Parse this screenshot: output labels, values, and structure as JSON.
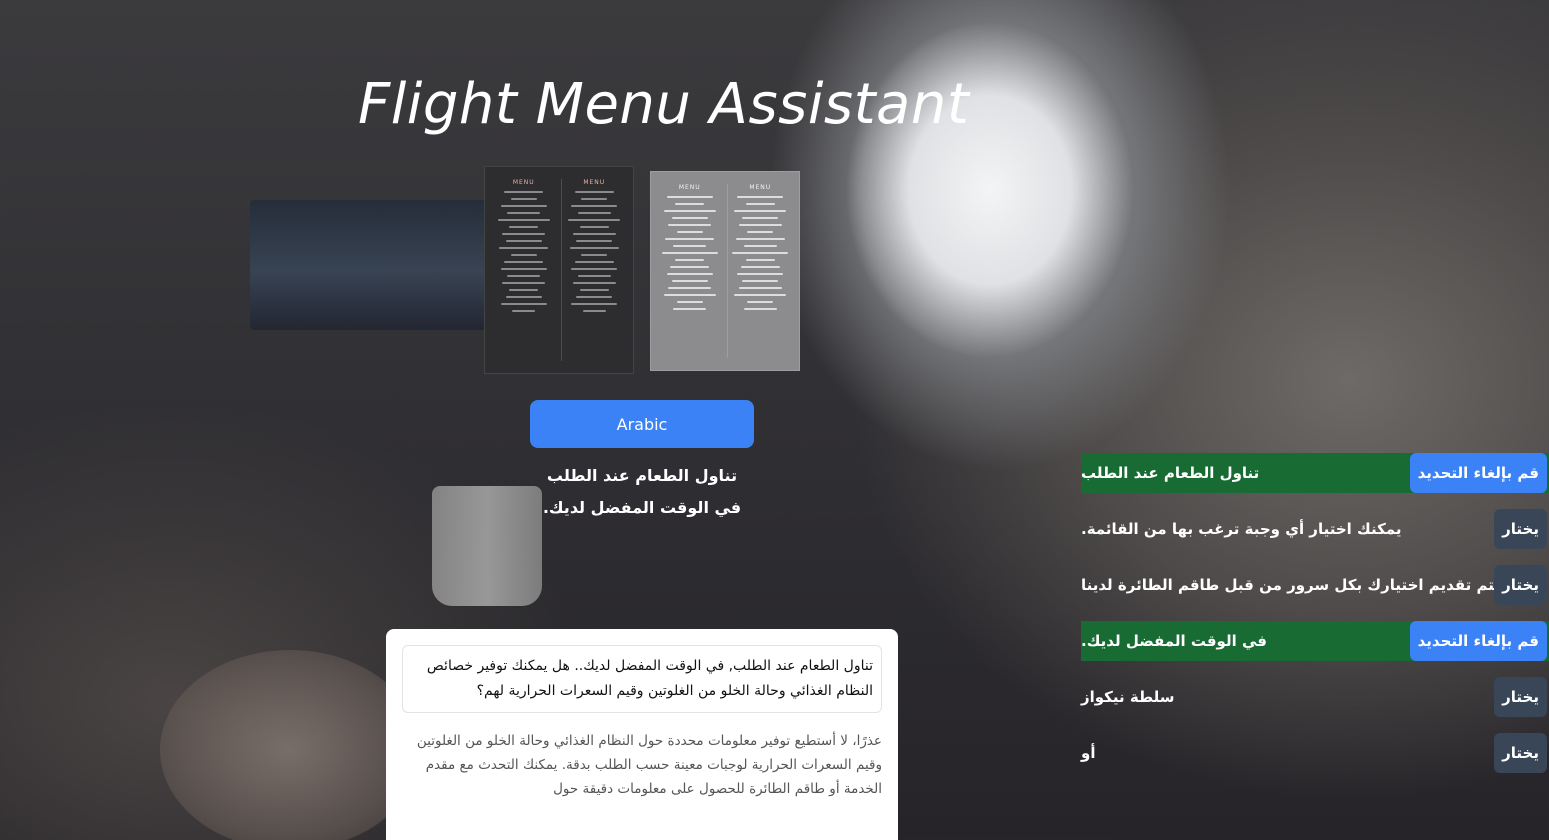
{
  "app": {
    "title": "Flight Menu Assistant"
  },
  "menus": [
    {
      "heading_left": "MENU",
      "heading_right": "MENU",
      "style": "dark"
    },
    {
      "heading_left": "MENU",
      "heading_right": "MENU",
      "style": "light"
    }
  ],
  "language_button": {
    "label": "Arabic"
  },
  "selected_caption": {
    "line1": "تناول الطعام عند الطلب",
    "line2": ".في الوقت المفضل لديك"
  },
  "chat": {
    "question": "تناول الطعام عند الطلب, في الوقت المفضل لديك.. هل يمكنك توفير خصائص النظام الغذائي وحالة الخلو من الغلوتين وقيم السعرات الحرارية لهم؟",
    "answer": "عذرًا، لا أستطيع توفير معلومات محددة حول النظام الغذائي وحالة الخلو من الغلوتين وقيم السعرات الحرارية لوجبات معينة حسب الطلب بدقة. يمكنك التحدث مع مقدم الخدمة أو طاقم الطائرة للحصول على معلومات دقيقة حول"
  },
  "sentences": [
    {
      "text": "تناول الطعام عند الطلب",
      "selected": true,
      "button": "قم بإلغاء التحديد"
    },
    {
      "text": ".يمكنك اختيار أي وجبة ترغب بها من القائمة",
      "selected": false,
      "button": "يختار"
    },
    {
      "text": "سيتم تقديم اختيارك بكل سرور من قبل طاقم الطائرة لدينا",
      "selected": false,
      "button": "يختار"
    },
    {
      "text": ".في الوقت المفضل لديك",
      "selected": true,
      "button": "قم بإلغاء التحديد"
    },
    {
      "text": "سلطة نيكواز",
      "selected": false,
      "button": "يختار"
    },
    {
      "text": "أو",
      "selected": false,
      "button": "يختار"
    }
  ],
  "colors": {
    "primary_button": "#3b82f6",
    "choose_button": "#394657",
    "selected_row": "#176b33"
  }
}
